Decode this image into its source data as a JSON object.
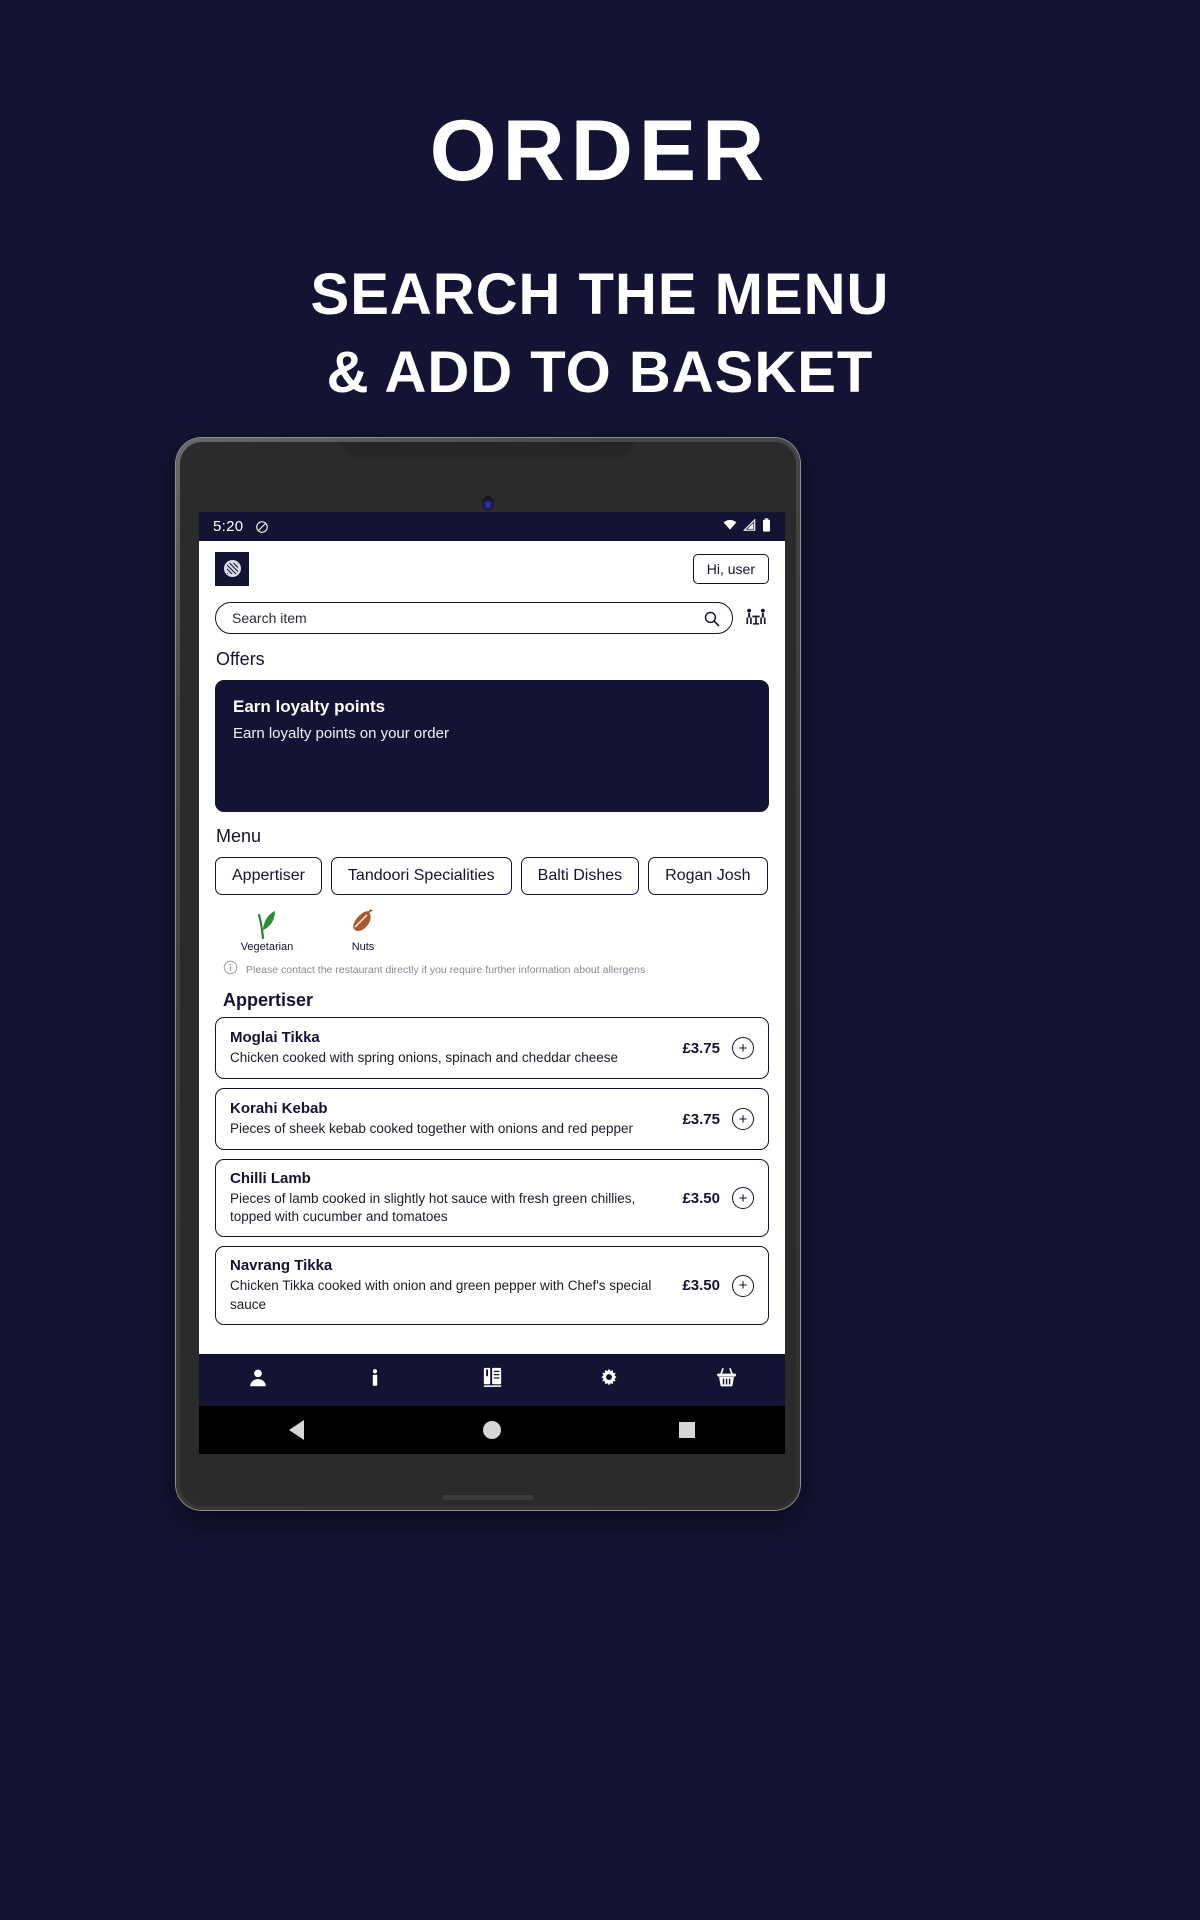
{
  "promo": {
    "title": "ORDER",
    "subtitle_line1": "SEARCH THE MENU",
    "subtitle_line2": "& ADD TO BASKET"
  },
  "colors": {
    "background": "#141333",
    "screen": "#ffffff",
    "accent": "#141333",
    "muted_text": "#888893",
    "veg_green": "#2e7d32",
    "nut_brown": "#a9572e"
  },
  "statusbar": {
    "time": "5:20",
    "dnd_icon": "do-not-disturb-icon",
    "wifi_icon": "wifi-icon",
    "signal_icon": "cellular-signal-icon",
    "battery_icon": "battery-icon"
  },
  "header": {
    "logo_icon": "restaurant-logo-icon",
    "account_label": "Hi, user"
  },
  "search": {
    "placeholder": "Search item",
    "search_icon": "search-icon",
    "table_booking_icon": "table-booking-icon"
  },
  "offers": {
    "section_title": "Offers",
    "card": {
      "title": "Earn loyalty points",
      "subtitle": "Earn loyalty points on your order"
    }
  },
  "menu": {
    "section_title": "Menu",
    "categories": [
      {
        "label": "Appertiser"
      },
      {
        "label": "Tandoori Specialities"
      },
      {
        "label": "Balti Dishes"
      },
      {
        "label": "Rogan Josh"
      }
    ],
    "legend": [
      {
        "label": "Vegetarian",
        "icon": "vegetarian-leaf-icon"
      },
      {
        "label": "Nuts",
        "icon": "nuts-icon"
      }
    ],
    "allergen_note": "Please contact the restaurant directly if you require further information about allergens",
    "allergen_note_icon": "info-icon",
    "group_title": "Appertiser",
    "items": [
      {
        "name": "Moglai Tikka",
        "description": "Chicken cooked with spring onions, spinach and cheddar cheese",
        "price": "£3.75",
        "add_label": "+"
      },
      {
        "name": "Korahi Kebab",
        "description": "Pieces of sheek kebab cooked together with onions and red pepper",
        "price": "£3.75",
        "add_label": "+"
      },
      {
        "name": "Chilli Lamb",
        "description": "Pieces of lamb cooked in slightly hot sauce with fresh green chillies, topped with cucumber and tomatoes",
        "price": "£3.50",
        "add_label": "+"
      },
      {
        "name": "Navrang Tikka",
        "description": "Chicken Tikka cooked with onion and green pepper with Chef's special sauce",
        "price": "£3.50",
        "add_label": "+"
      }
    ]
  },
  "bottom_nav": [
    {
      "icon": "account-person-icon",
      "name": "account"
    },
    {
      "icon": "info-icon",
      "name": "info"
    },
    {
      "icon": "menu-book-icon",
      "name": "menu"
    },
    {
      "icon": "settings-gear-icon",
      "name": "settings"
    },
    {
      "icon": "basket-icon",
      "name": "basket"
    }
  ],
  "system_nav": [
    {
      "icon": "back-triangle-icon",
      "name": "back"
    },
    {
      "icon": "home-circle-icon",
      "name": "home"
    },
    {
      "icon": "recents-square-icon",
      "name": "recents"
    }
  ]
}
